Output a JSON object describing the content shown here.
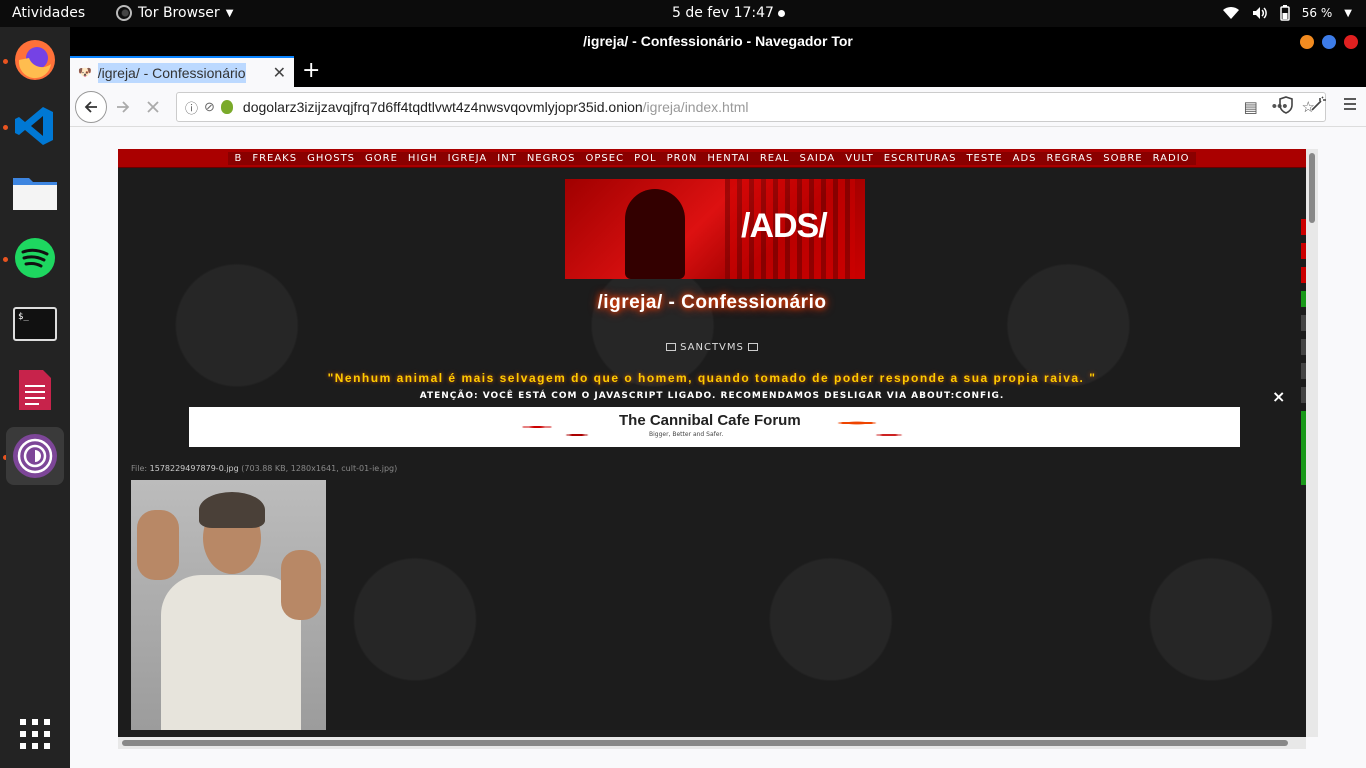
{
  "system_bar": {
    "activities": "Atividades",
    "app_name": "Tor Browser",
    "clock": "5 de fev  17:47",
    "battery": "56 %"
  },
  "window": {
    "title": "/igreja/ - Confessionário - Navegador Tor",
    "tab_title": "/igreja/ - Confessionário",
    "url_host": "dogolarz3izijzavqjfrq7d6ff4tqdtlvwt4z4nwsvqovmlyjopr35id.onion",
    "url_path": "/igreja/index.html"
  },
  "dock": {
    "items": [
      "firefox-icon",
      "vscode-icon",
      "files-icon",
      "spotify-icon",
      "terminal-icon",
      "text-editor-icon",
      "tor-browser-icon",
      "app-grid-icon"
    ],
    "terminal_glyph": "$_"
  },
  "page": {
    "nav_links": [
      "B",
      "FREAKS",
      "GHOSTS",
      "GORE",
      "HIGH",
      "IGREJA",
      "INT",
      "NEGROS",
      "OPSEC",
      "POL",
      "PR0N",
      "HENTAI",
      "REAL",
      "SAIDA",
      "VULT",
      "ESCRITURAS",
      "TESTE",
      "ADS",
      "REGRAS",
      "SOBRE",
      "RADIO"
    ],
    "banner_text": "/ADS/",
    "board_title": "/igreja/ - Confessionário",
    "sanctvms": "SANCTVMS",
    "quote": "\"Nenhum animal é mais selvagem do que o homem, quando tomado de poder responde a sua propia raiva. \"",
    "js_warning": "ATENÇÃO: VOCÊ ESTÁ COM O JAVASCRIPT LIGADO. RECOMENDAMOS DESLIGAR VIA ABOUT:CONFIG.",
    "warning_close": "×",
    "ad_title": "The Cannibal Cafe Forum",
    "ad_subtitle": "Bigger, Better and Safer.",
    "file_label": "File:",
    "file_name": "1578229497879-0.jpg",
    "file_meta": "(703.88 KB, 1280x1641, cult-01-ie.jpg)"
  },
  "colors": {
    "nav_red": "#aa0000",
    "accent_tab": "#0a84ff",
    "quote_yellow": "#ffcc00"
  }
}
